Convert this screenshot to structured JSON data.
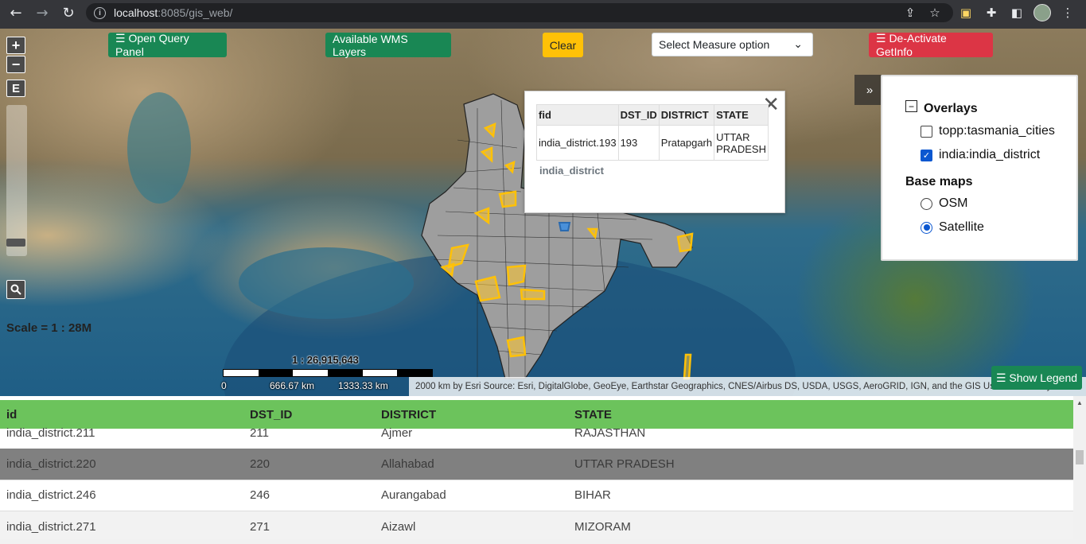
{
  "browser": {
    "url_host": "localhost",
    "url_rest": ":8085/gis_web/",
    "back_icon": "arrow-left-icon",
    "forward_icon": "arrow-right-icon",
    "reload_icon": "reload-icon"
  },
  "toolbar": {
    "open_query": "☰ Open Query Panel",
    "wms_layers": "Available WMS Layers",
    "clear": "Clear",
    "measure_select": "Select Measure option",
    "getinfo": "☰ De-Activate GetInfo"
  },
  "map_controls": {
    "zoom_in": "+",
    "zoom_out": "−",
    "extent": "E"
  },
  "scale": {
    "label": "Scale = 1 : 28M",
    "ratio": "1 : 26,915,643",
    "ticks": [
      "0",
      "666.67 km",
      "1333.33 km",
      "2000 km"
    ]
  },
  "attribution": "by Esri Source: Esri, DigitalGlobe, GeoEye, Earthstar Geographics, CNES/Airbus DS, USDA, USGS, AeroGRID, IGN, and the GIS User Community",
  "show_legend": "☰ Show Legend",
  "popup": {
    "close": "✕",
    "headers": [
      "fid",
      "DST_ID",
      "DISTRICT",
      "STATE"
    ],
    "row": [
      "india_district.193",
      "193",
      "Pratapgarh",
      "UTTAR PRADESH"
    ],
    "layer": "india_district"
  },
  "layer_switcher": {
    "toggle": "»",
    "overlays_title": "Overlays",
    "overlays": [
      {
        "label": "topp:tasmania_cities",
        "checked": false
      },
      {
        "label": "india:india_district",
        "checked": true
      }
    ],
    "basemaps_title": "Base maps",
    "basemaps": [
      {
        "label": "OSM",
        "selected": false
      },
      {
        "label": "Satellite",
        "selected": true
      }
    ]
  },
  "attribute_table": {
    "headers": [
      "id",
      "DST_ID",
      "DISTRICT",
      "STATE"
    ],
    "rows": [
      {
        "id": "india_district.211",
        "dst": "211",
        "district": "Ajmer",
        "state": "RAJASTHAN"
      },
      {
        "id": "india_district.220",
        "dst": "220",
        "district": "Allahabad",
        "state": "UTTAR PRADESH"
      },
      {
        "id": "india_district.246",
        "dst": "246",
        "district": "Aurangabad",
        "state": "BIHAR"
      },
      {
        "id": "india_district.271",
        "dst": "271",
        "district": "Aizawl",
        "state": "MIZORAM"
      }
    ]
  }
}
